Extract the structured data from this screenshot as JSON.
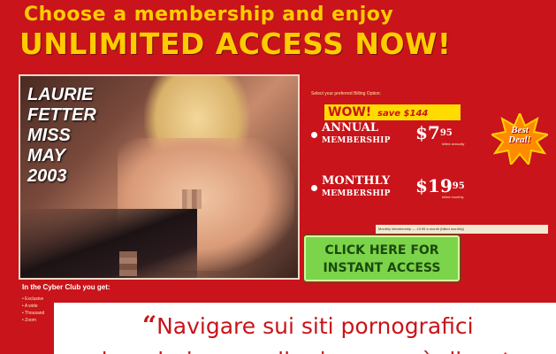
{
  "header": {
    "line1": "Choose a membership and enjoy",
    "line2": "UNLIMITED ACCESS NOW!"
  },
  "model": {
    "name_lines": [
      "LAURIE",
      "FETTER",
      "MISS",
      "MAY",
      "2003"
    ]
  },
  "offer": {
    "billing_prompt": "Select your preferred Billing Option:",
    "wow": "WOW!",
    "save": "save $144",
    "best_deal": [
      "Best",
      "Deal!"
    ],
    "plans": [
      {
        "name_line1": "ANNUAL",
        "name_line2": "MEMBERSHIP",
        "price": "$7",
        "price_cents": "95",
        "note": "billed annually"
      },
      {
        "name_line1": "MONTHLY",
        "name_line2": "MEMBERSHIP",
        "price": "$19",
        "price_cents": "95",
        "note": "billed monthly"
      }
    ],
    "fineprint": "Monthly Membership — 19.95 a month (billed monthly)",
    "cta_line1": "CLICK HERE FOR",
    "cta_line2": "INSTANT ACCESS"
  },
  "cyber_club": {
    "heading": "In the Cyber Club you get:",
    "items": [
      "• Exclusive",
      "• A wide",
      "• Thousand",
      "• Zoom"
    ]
  },
  "quote": {
    "open_mark": "“",
    "text": "Navigare sui siti pornografici",
    "line2": "che aderiscono alla ricerca può diventare"
  },
  "colors": {
    "background": "#c8141a",
    "headline": "#ffcc00",
    "cta": "#7cd44a",
    "quote_text": "#c8141a"
  }
}
